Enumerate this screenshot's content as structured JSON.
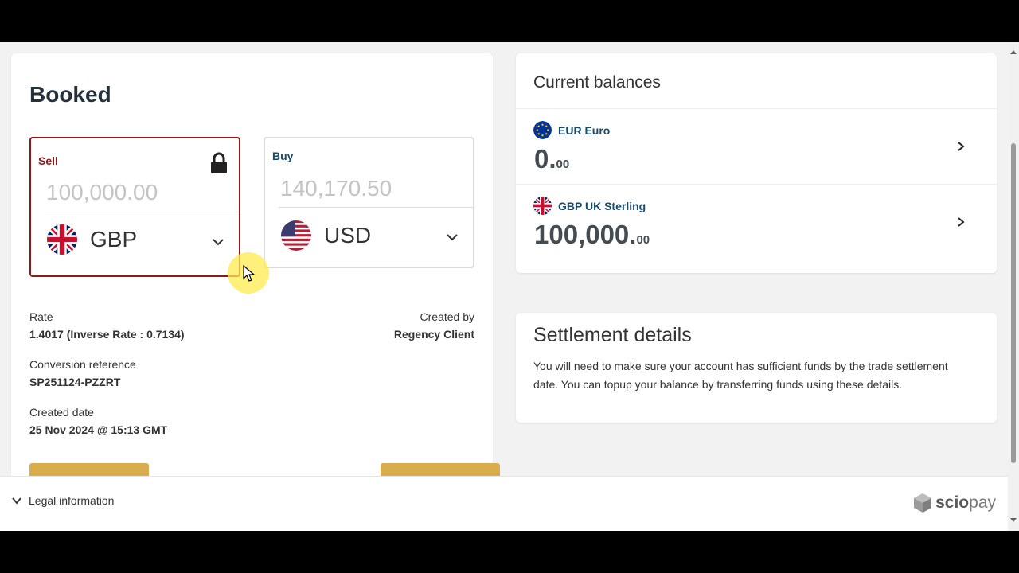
{
  "booked": {
    "title": "Booked",
    "sell": {
      "label": "Sell",
      "amount": "100,000.00",
      "currency": "GBP"
    },
    "buy": {
      "label": "Buy",
      "amount": "140,170.50",
      "currency": "USD"
    },
    "rate": {
      "label": "Rate",
      "value": "1.4017 (Inverse Rate : 0.7134)"
    },
    "created_by": {
      "label": "Created by",
      "value": "Regency Client"
    },
    "conversion_reference": {
      "label": "Conversion reference",
      "value": "SP251124-PZZRT"
    },
    "created_date": {
      "label": "Created date",
      "value": "25 Nov 2024 @ 15:13 GMT"
    }
  },
  "balances": {
    "title": "Current balances",
    "items": [
      {
        "code": "EUR",
        "name": "EUR Euro",
        "whole": "0.",
        "decimals": "00"
      },
      {
        "code": "GBP",
        "name": "GBP UK Sterling",
        "whole": "100,000.",
        "decimals": "00"
      }
    ]
  },
  "settlement": {
    "title": "Settlement details",
    "text": "You will need to make sure your account has sufficient funds by the trade settlement date. You can topup your balance by transferring funds using these details."
  },
  "footer": {
    "legal_label": "Legal information",
    "logo_prefix": "scio",
    "logo_suffix": "pay"
  },
  "colors": {
    "sell_border": "#8b1a1a",
    "accent_navy": "#1a4a6b",
    "action_button": "#d9ad4c"
  }
}
